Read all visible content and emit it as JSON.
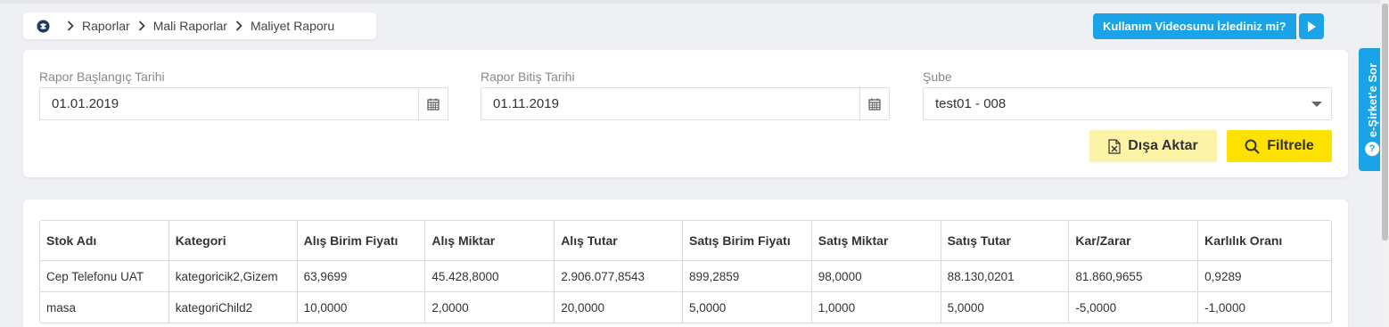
{
  "breadcrumb": {
    "items": [
      "Raporlar",
      "Mali Raporlar",
      "Maliyet Raporu"
    ]
  },
  "video_prompt": {
    "label": "Kullanım Videosunu İzlediniz mi?"
  },
  "side_tab": {
    "label": "e-Şirket'e Sor"
  },
  "filters": {
    "start_date": {
      "label": "Rapor Başlangıç Tarihi",
      "value": "01.01.2019"
    },
    "end_date": {
      "label": "Rapor Bitiş Tarihi",
      "value": "01.11.2019"
    },
    "branch": {
      "label": "Şube",
      "value": "test01 - 008"
    },
    "export_label": "Dışa Aktar",
    "filter_label": "Filtrele"
  },
  "table": {
    "columns": [
      "Stok Adı",
      "Kategori",
      "Alış Birim Fiyatı",
      "Alış Miktar",
      "Alış Tutar",
      "Satış Birim Fiyatı",
      "Satış Miktar",
      "Satış Tutar",
      "Kar/Zarar",
      "Karlılık Oranı"
    ],
    "rows": [
      [
        "Cep Telefonu UAT",
        "kategoricik2,Gizem",
        "63,9699",
        "45.428,8000",
        "2.906.077,8543",
        "899,2859",
        "98,0000",
        "88.130,0201",
        "81.860,9655",
        "0,9289"
      ],
      [
        "masa",
        "kategoriChild2",
        "10,0000",
        "2,0000",
        "20,0000",
        "5,0000",
        "1,0000",
        "5,0000",
        "-5,0000",
        "-1,0000"
      ]
    ]
  },
  "colors": {
    "accent_blue": "#1aa3e6",
    "filter_yellow": "#ffe100",
    "export_yellow": "#fdf3a7"
  }
}
